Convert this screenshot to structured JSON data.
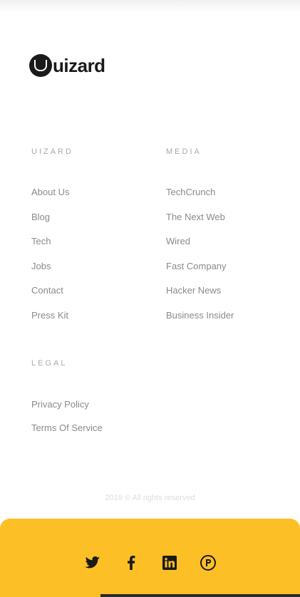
{
  "brand": {
    "logo_text": "uizard"
  },
  "columns": {
    "uizard": {
      "heading": "UIZARD",
      "links": [
        "About Us",
        "Blog",
        "Tech",
        "Jobs",
        "Contact",
        "Press Kit"
      ]
    },
    "media": {
      "heading": "MEDIA",
      "links": [
        "TechCrunch",
        "The Next Web",
        "Wired",
        "Fast Company",
        "Hacker News",
        "Business Insider"
      ]
    },
    "legal": {
      "heading": "LEGAL",
      "links": [
        "Privacy Policy",
        "Terms Of Service"
      ]
    }
  },
  "copyright": "2019 © All rights reserved",
  "social": {
    "background": "#fcbf25",
    "icons": [
      "twitter-icon",
      "facebook-icon",
      "linkedin-icon",
      "product-hunt-icon"
    ]
  }
}
